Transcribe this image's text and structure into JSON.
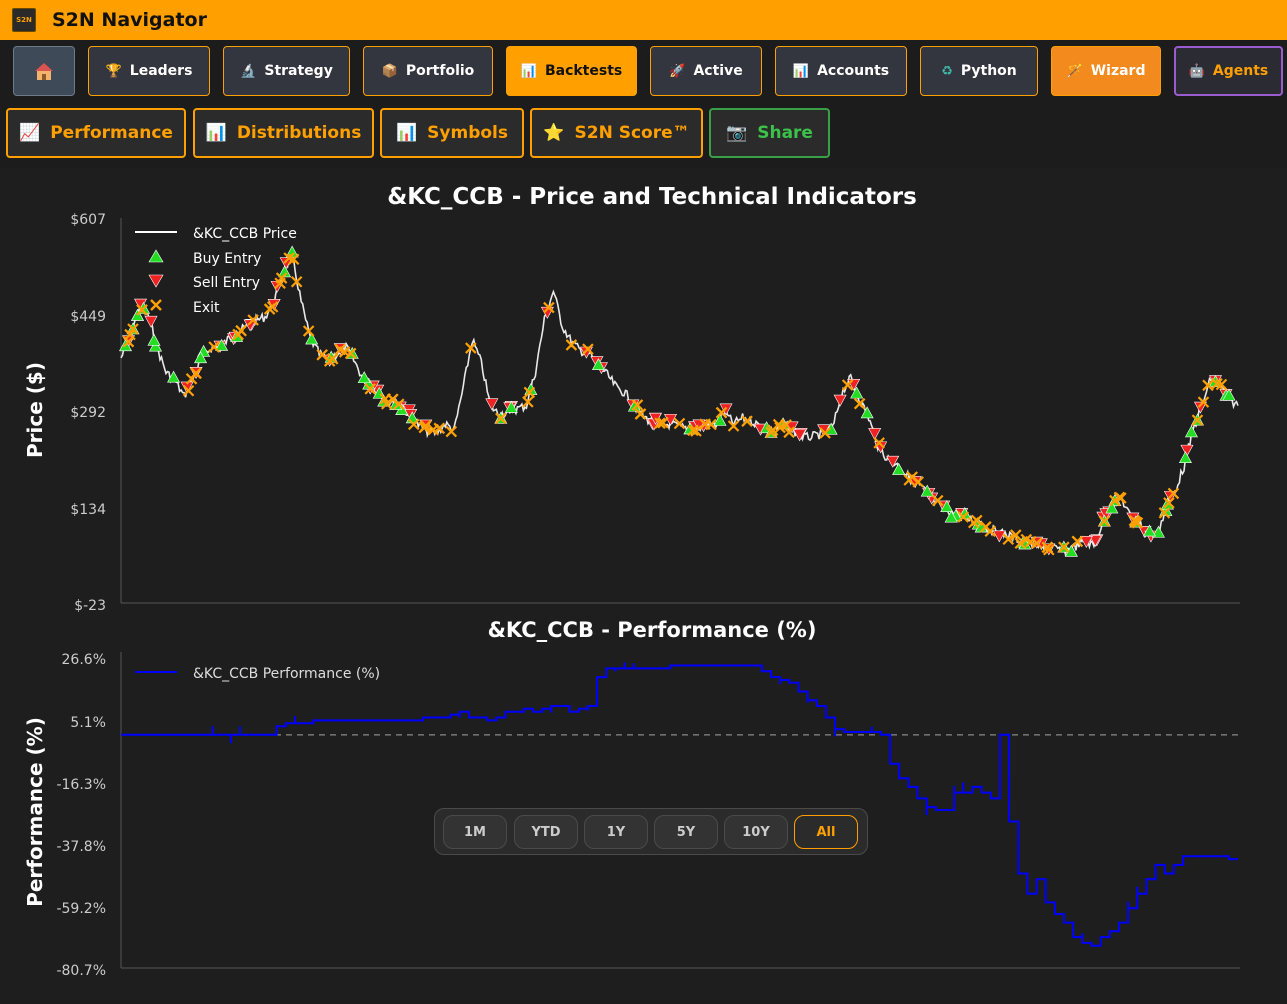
{
  "app": {
    "title": "S2N Navigator",
    "logo_text": "S2N"
  },
  "nav": {
    "home_icon": "house-icon",
    "items": [
      {
        "label": "Leaders",
        "icon": "trophy-icon"
      },
      {
        "label": "Strategy",
        "icon": "microscope-icon"
      },
      {
        "label": "Portfolio",
        "icon": "package-icon"
      },
      {
        "label": "Backtests",
        "icon": "bar-chart-icon"
      },
      {
        "label": "Active",
        "icon": "rocket-icon"
      },
      {
        "label": "Accounts",
        "icon": "bar-chart-icon"
      },
      {
        "label": "Python",
        "icon": "python-icon"
      },
      {
        "label": "Wizard",
        "icon": "wand-icon"
      },
      {
        "label": "Agents",
        "icon": "robot-icon"
      }
    ],
    "active": "Backtests"
  },
  "subnav": {
    "items": [
      {
        "label": "Performance",
        "icon": "trend-chart-icon"
      },
      {
        "label": "Distributions",
        "icon": "bar-chart-icon"
      },
      {
        "label": "Symbols",
        "icon": "bar-chart-icon"
      },
      {
        "label": "S2N Score™",
        "icon": "star-icon"
      },
      {
        "label": "Share",
        "icon": "camera-icon"
      }
    ]
  },
  "colors": {
    "accent": "#ffa000",
    "price_line": "#e8e8e8",
    "buy": "#22dd22",
    "sell": "#ee2222",
    "exit": "#ffa000",
    "performance_line": "#0000ff",
    "agents_border": "#9b5ccf",
    "share_border": "#3aa045"
  },
  "range": {
    "options": [
      "1M",
      "YTD",
      "1Y",
      "5Y",
      "10Y",
      "All"
    ],
    "selected": "All"
  },
  "chart_data": [
    {
      "type": "line",
      "title": "&KC_CCB - Price and Technical Indicators",
      "ylabel": "Price ($)",
      "xlabel": "",
      "ytick_labels": [
        "$607",
        "$449",
        "$292",
        "$134",
        "$-23"
      ],
      "ylim": [
        -23,
        607
      ],
      "legend": {
        "placement": "top-left",
        "entries": [
          "&KC_CCB Price",
          "Buy Entry",
          "Sell Entry",
          "Exit"
        ]
      },
      "series": [
        {
          "name": "&KC_CCB Price",
          "values": [
            378,
            410,
            460,
            450,
            395,
            355,
            340,
            315,
            345,
            380,
            395,
            395,
            410,
            420,
            430,
            440,
            445,
            470,
            520,
            545,
            470,
            410,
            385,
            375,
            385,
            395,
            370,
            340,
            330,
            315,
            305,
            300,
            285,
            268,
            258,
            255,
            270,
            260,
            330,
            408,
            370,
            300,
            285,
            290,
            295,
            300,
            355,
            440,
            488,
            430,
            405,
            390,
            385,
            368,
            350,
            330,
            320,
            300,
            282,
            272,
            268,
            270,
            265,
            262,
            262,
            270,
            268,
            290,
            270,
            280,
            275,
            266,
            260,
            263,
            265,
            255,
            248,
            250,
            255,
            262,
            320,
            345,
            310,
            280,
            235,
            215,
            205,
            190,
            175,
            165,
            145,
            135,
            125,
            120,
            115,
            110,
            100,
            95,
            90,
            85,
            78,
            72,
            70,
            68,
            65,
            64,
            70,
            80,
            70,
            110,
            135,
            150,
            120,
            110,
            90,
            90,
            130,
            160,
            200,
            260,
            300,
            345,
            335,
            310,
            300
          ]
        }
      ],
      "signals": {
        "buy_count": 70,
        "sell_count": 75,
        "exit_count": 110
      }
    },
    {
      "type": "line",
      "title": "&KC_CCB - Performance (%)",
      "ylabel": "Performance (%)",
      "xlabel": "",
      "ytick_labels": [
        "26.6%",
        "5.1%",
        "-16.3%",
        "-37.8%",
        "-59.2%",
        "-80.7%"
      ],
      "ylim": [
        -80.7,
        26.6
      ],
      "baseline": 0,
      "legend": {
        "placement": "top-left",
        "entries": [
          "&KC_CCB Performance (%)"
        ]
      },
      "series": [
        {
          "name": "&KC_CCB Performance (%)",
          "values": [
            0,
            0,
            0,
            0,
            0,
            0,
            0,
            0,
            0,
            0,
            0,
            0,
            0,
            0,
            0,
            0,
            0,
            3,
            4,
            4,
            4,
            5,
            5,
            5,
            5,
            5,
            5,
            5,
            5,
            5,
            5,
            5,
            5,
            6,
            6,
            6,
            7,
            8,
            6,
            6,
            5,
            6,
            8,
            8,
            9,
            8,
            9,
            10,
            10,
            8,
            9,
            10,
            20,
            23,
            23,
            23,
            23,
            23,
            23,
            23,
            24,
            24,
            24,
            24,
            24,
            24,
            24,
            24,
            24,
            24,
            22,
            20,
            19,
            18,
            15,
            12,
            10,
            6,
            2,
            1,
            1,
            1,
            1,
            0,
            -10,
            -15,
            -18,
            -22,
            -25,
            -26,
            -26,
            -20,
            -20,
            -18,
            -20,
            -22,
            0,
            -30,
            -48,
            -55,
            -50,
            -58,
            -62,
            -65,
            -70,
            -72,
            -73,
            -70,
            -68,
            -65,
            -60,
            -55,
            -50,
            -45,
            -48,
            -45,
            -42,
            -42,
            -42,
            -42,
            -42,
            -43,
            -43
          ]
        }
      ]
    }
  ]
}
